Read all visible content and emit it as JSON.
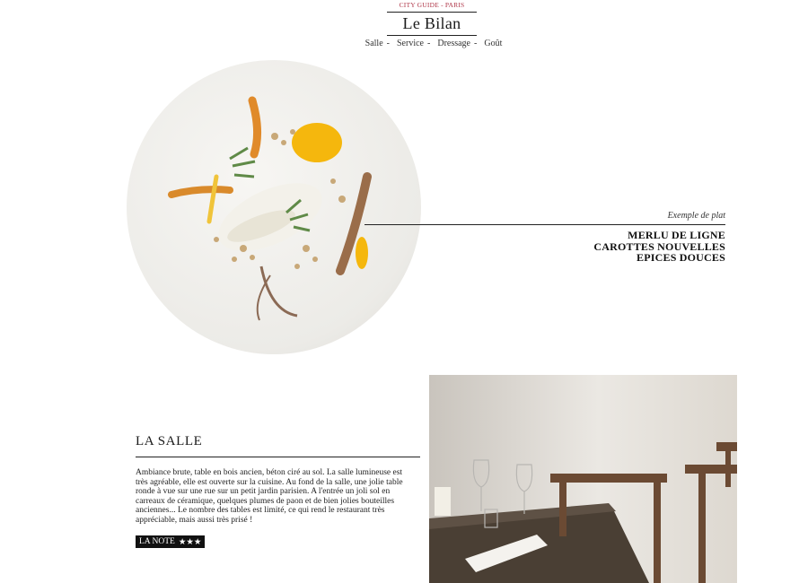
{
  "header": {
    "kicker": "CITY GUIDE - PARIS",
    "title": "Le Bilan",
    "nav": [
      {
        "label": "Salle"
      },
      {
        "label": "Service"
      },
      {
        "label": "Dressage"
      },
      {
        "label": "Goût"
      }
    ],
    "nav_separator": "-"
  },
  "dish": {
    "caption": "Exemple de plat",
    "name_lines": [
      "MERLU DE LIGNE",
      "CAROTTES NOUVELLES",
      "EPICES DOUCES"
    ]
  },
  "salle": {
    "title": "LA SALLE",
    "text": "Ambiance brute, table en bois ancien, béton ciré au sol. La salle lumineuse est très agréable, elle est ouverte sur la cuisine. Au fond de la salle, une jolie table ronde à vue sur une rue sur un petit jardin parisien. A l'entrée un joli sol en carreaux de céramique, quelques plumes de paon et de bien jolies bouteilles anciennes... Le nombre des tables est limité, ce qui rend le restaurant très appréciable, mais aussi très prisé !",
    "note_label": "LA NOTE",
    "note_stars": "★★★",
    "rating": 3
  },
  "colors": {
    "accent": "#b0384a",
    "text": "#1a1a1a",
    "badge_bg": "#111111"
  }
}
